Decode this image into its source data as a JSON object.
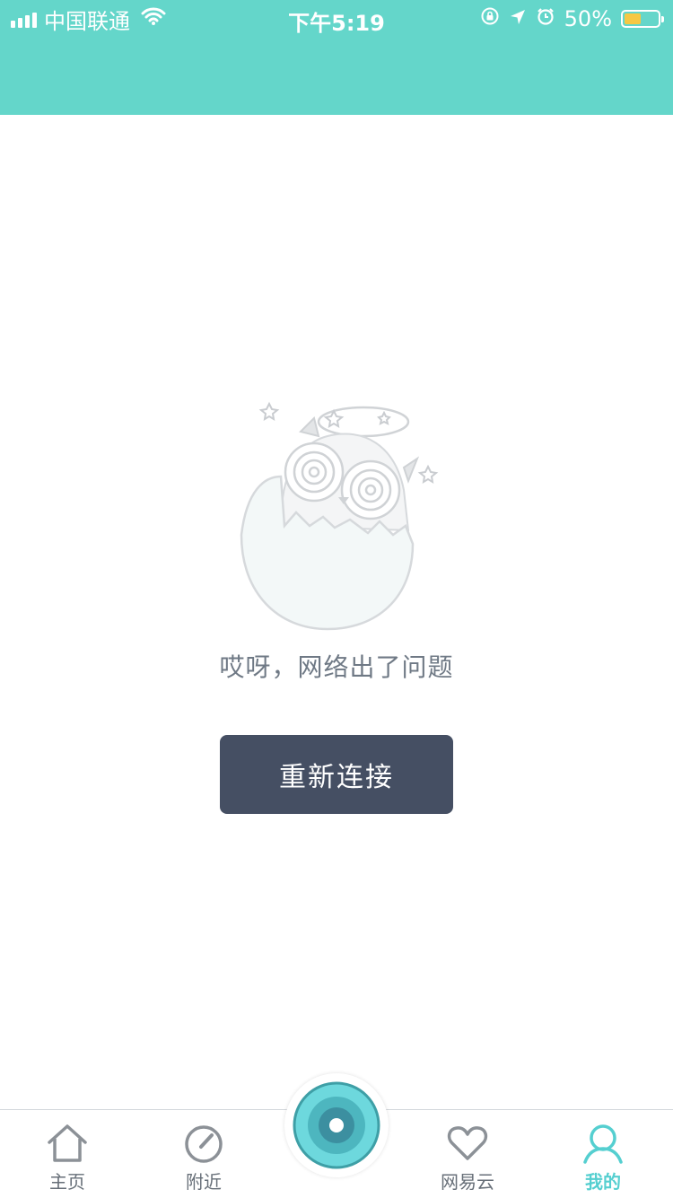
{
  "status_bar": {
    "carrier": "中国联通",
    "time": "下午5:19",
    "battery": "50%",
    "battery_level": 0.5
  },
  "colors": {
    "header": "#64d6ca",
    "button_bg": "#454f63",
    "active_tab": "#55cfd0",
    "battery_fill": "#f6c844"
  },
  "main": {
    "illustration": "broken-egg-owl-icon",
    "error_message": "哎呀，网络出了问题",
    "retry_label": "重新连接"
  },
  "tabbar": {
    "items": [
      {
        "label": "主页",
        "icon": "home-icon"
      },
      {
        "label": "附近",
        "icon": "compass-icon"
      },
      {
        "label": "网易云",
        "icon": "heart-icon"
      },
      {
        "label": "我的",
        "icon": "user-icon"
      }
    ],
    "center_icon": "record-icon",
    "active_index": 3
  }
}
